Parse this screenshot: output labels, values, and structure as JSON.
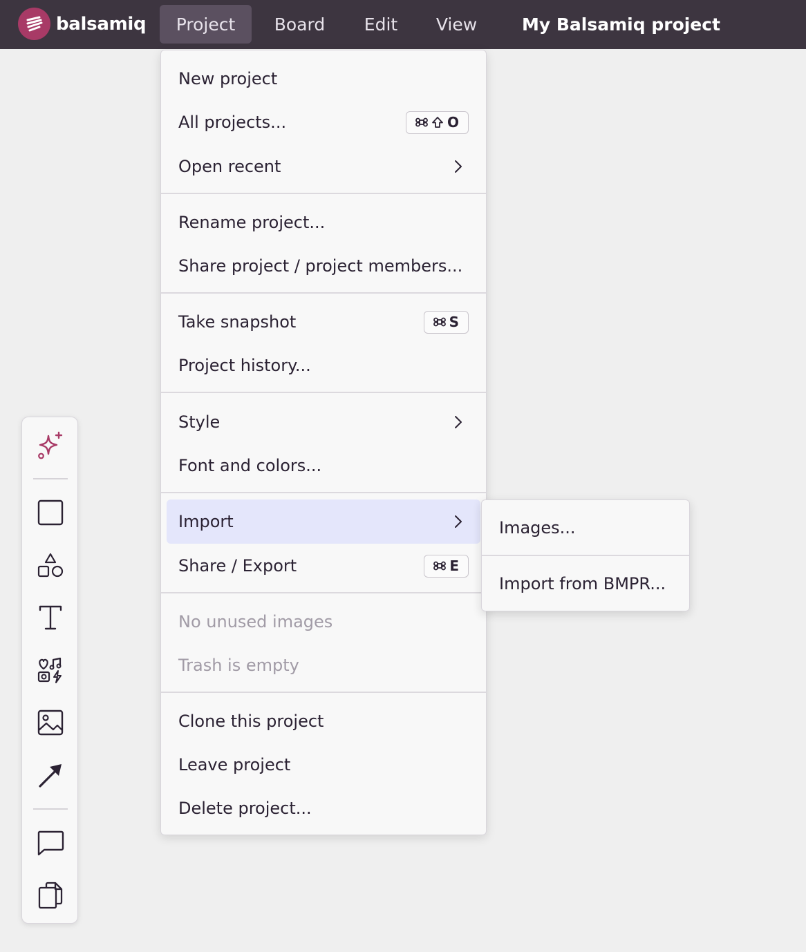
{
  "app": {
    "brand": "balsamiq",
    "project_title": "My Balsamiq project",
    "accent_color": "#a83a66",
    "topbar_color": "#3d3540"
  },
  "menubar": {
    "items": [
      {
        "label": "Project",
        "active": true
      },
      {
        "label": "Board",
        "active": false
      },
      {
        "label": "Edit",
        "active": false
      },
      {
        "label": "View",
        "active": false
      }
    ]
  },
  "project_menu": {
    "groups": [
      [
        {
          "label": "New project"
        },
        {
          "label": "All projects...",
          "shortcut": [
            "cmd-icon",
            "shift-icon",
            "O"
          ]
        },
        {
          "label": "Open recent",
          "submenu": true
        }
      ],
      [
        {
          "label": "Rename project..."
        },
        {
          "label": "Share project / project members..."
        }
      ],
      [
        {
          "label": "Take snapshot",
          "shortcut": [
            "cmd-icon",
            "S"
          ]
        },
        {
          "label": "Project history..."
        }
      ],
      [
        {
          "label": "Style",
          "submenu": true
        },
        {
          "label": "Font and colors..."
        }
      ],
      [
        {
          "label": "Import",
          "submenu": true,
          "highlighted": true
        },
        {
          "label": "Share / Export",
          "shortcut": [
            "cmd-icon",
            "E"
          ]
        }
      ],
      [
        {
          "label": "No unused images",
          "disabled": true
        },
        {
          "label": "Trash is empty",
          "disabled": true
        }
      ],
      [
        {
          "label": "Clone this project"
        },
        {
          "label": "Leave project"
        },
        {
          "label": "Delete project..."
        }
      ]
    ],
    "highlight_color": "#e4e6fb"
  },
  "import_submenu": {
    "items": [
      {
        "label": "Images..."
      },
      {
        "label": "Import from BMPR..."
      }
    ]
  },
  "toolbar": {
    "tools": [
      "sparkles-icon",
      "rectangle-icon",
      "shapes-icon",
      "text-icon",
      "icons-library-icon",
      "image-icon",
      "arrow-icon",
      "comment-icon",
      "copy-icon"
    ]
  }
}
